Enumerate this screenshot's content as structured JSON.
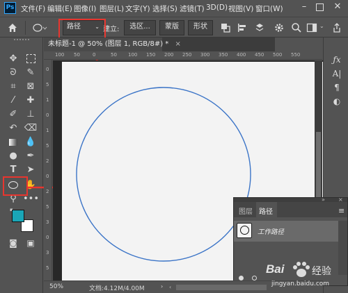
{
  "app": {
    "logo": "Ps"
  },
  "menu": {
    "items": [
      "文件(F)",
      "编辑(E)",
      "图像(I)",
      "图层(L)",
      "文字(Y)",
      "选择(S)",
      "滤镜(T)",
      "3D(D)",
      "视图(V)",
      "窗口(W)"
    ]
  },
  "options": {
    "mode_select": "路径",
    "make_label": "建立:",
    "selection_btn": "选区...",
    "mask_btn": "蒙版",
    "shape_btn": "形状"
  },
  "document": {
    "tab_title": "未标题-1 @ 50% (图层 1, RGB/8#) *",
    "tab_close": "×",
    "zoom": "50%",
    "doc_info": "文档:4.12M/4.00M"
  },
  "rulers": {
    "top": [
      "100",
      "50",
      "0",
      "50",
      "100",
      "150",
      "200",
      "250",
      "300",
      "350",
      "400",
      "450",
      "500",
      "550"
    ],
    "left": [
      "0",
      "5",
      "1",
      "0",
      "1",
      "5",
      "2",
      "0",
      "2",
      "5",
      "3",
      "0",
      "3",
      "5"
    ]
  },
  "paths_panel": {
    "tab_layers": "图层",
    "tab_paths": "路径",
    "path_name": "工作路径"
  },
  "watermark": {
    "brand": "Bai",
    "brand2": "经验",
    "url": "jingyan.baidu.com"
  },
  "colors": {
    "annotation_red": "#e8352e",
    "foreground": "#1aa6b7",
    "background": "#ffffff",
    "path_stroke": "#3b74c7"
  }
}
